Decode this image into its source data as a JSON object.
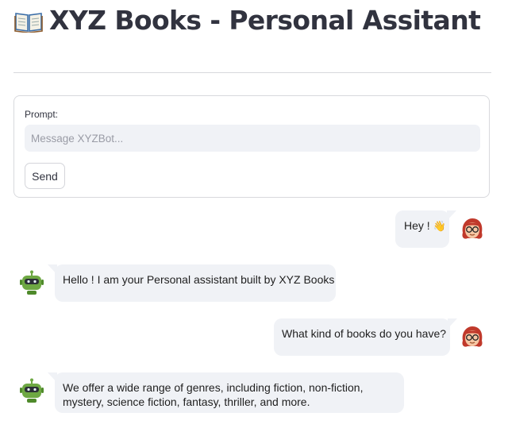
{
  "header": {
    "title": "XYZ Books - Personal Assitant",
    "icon": "open-book-icon"
  },
  "form": {
    "label": "Prompt:",
    "input_value": "",
    "placeholder": "Message XYZBot...",
    "send_label": "Send"
  },
  "messages": [
    {
      "role": "user",
      "text": "Hey !",
      "emoji": "👋",
      "avatar": "user-avatar-icon"
    },
    {
      "role": "bot",
      "text": "Hello ! I am your Personal assistant built by XYZ Books",
      "avatar": "robot-avatar-icon"
    },
    {
      "role": "user",
      "text": "What kind of books do you have?",
      "avatar": "user-avatar-icon"
    },
    {
      "role": "bot",
      "line1": "We offer a wide range of genres, including fiction, non-fiction,",
      "line2": "mystery, science fiction, fantasy, thriller, and more.",
      "avatar": "robot-avatar-icon"
    }
  ],
  "colors": {
    "bubble": "#f0f2f6",
    "bot_green": "#6ea843",
    "user_hair": "#c0392b",
    "title": "#31333f"
  }
}
